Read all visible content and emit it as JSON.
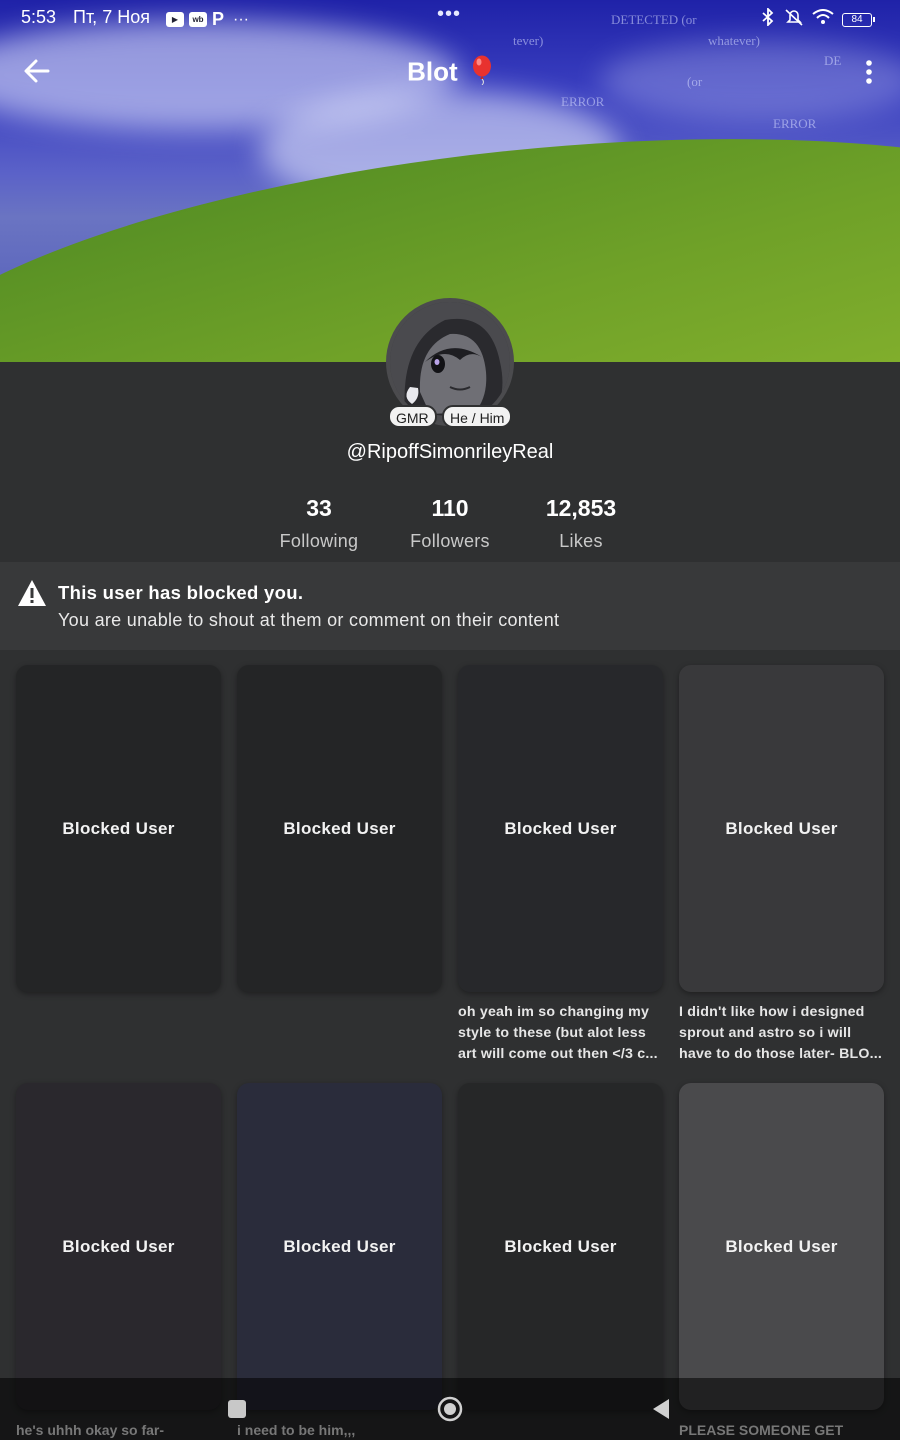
{
  "status_bar": {
    "time": "5:53",
    "date": "Пт, 7 Ноя",
    "apps": [
      "YT",
      "wb",
      "P"
    ],
    "overflow": "···",
    "notch_dots": "•••",
    "battery": "84",
    "icons": [
      "bluetooth-icon",
      "bell-off-icon",
      "wifi-icon",
      "battery-icon"
    ]
  },
  "banner": {
    "texts": [
      "DETECTED (or",
      "whatever)",
      "ERROR",
      "(or",
      "ERROR",
      "DE",
      "tever)"
    ]
  },
  "header": {
    "title": "Blot",
    "title_emoji": "balloon",
    "back_icon": "arrow-left-icon",
    "more_icon": "more-vertical-icon"
  },
  "profile": {
    "badges": [
      "GMR",
      "He / Him"
    ],
    "handle": "@RipoffSimonrileyReal",
    "stats": [
      {
        "value": "33",
        "label": "Following"
      },
      {
        "value": "110",
        "label": "Followers"
      },
      {
        "value": "12,853",
        "label": "Likes"
      }
    ]
  },
  "notice": {
    "icon": "warning-icon",
    "title": "This user has blocked you.",
    "body": "You are unable to shout at them or comment on their content"
  },
  "posts": [
    {
      "label": "Blocked User",
      "color": "#242526",
      "caption": ""
    },
    {
      "label": "Blocked User",
      "color": "#242526",
      "caption": ""
    },
    {
      "label": "Blocked User",
      "color": "#27282b",
      "caption": "oh yeah im so changing my style to these (but alot less art will come out then </3 c..."
    },
    {
      "label": "Blocked User",
      "color": "#39393b",
      "caption": "I didn't like how i designed sprout and astro so i will have to do those later- BLO..."
    },
    {
      "label": "Blocked User",
      "color": "#2a282d",
      "caption": "he's uhhh okay so far-"
    },
    {
      "label": "Blocked User",
      "color": "#2a2c3b",
      "caption": "i need to be him,,,"
    },
    {
      "label": "Blocked User",
      "color": "#262728",
      "caption": ""
    },
    {
      "label": "Blocked User",
      "color": "#4a4a4c",
      "caption": "PLEASE SOMEONE GET"
    }
  ],
  "nav_bar": {
    "icons": [
      "recents-icon",
      "home-icon",
      "back-icon"
    ]
  }
}
